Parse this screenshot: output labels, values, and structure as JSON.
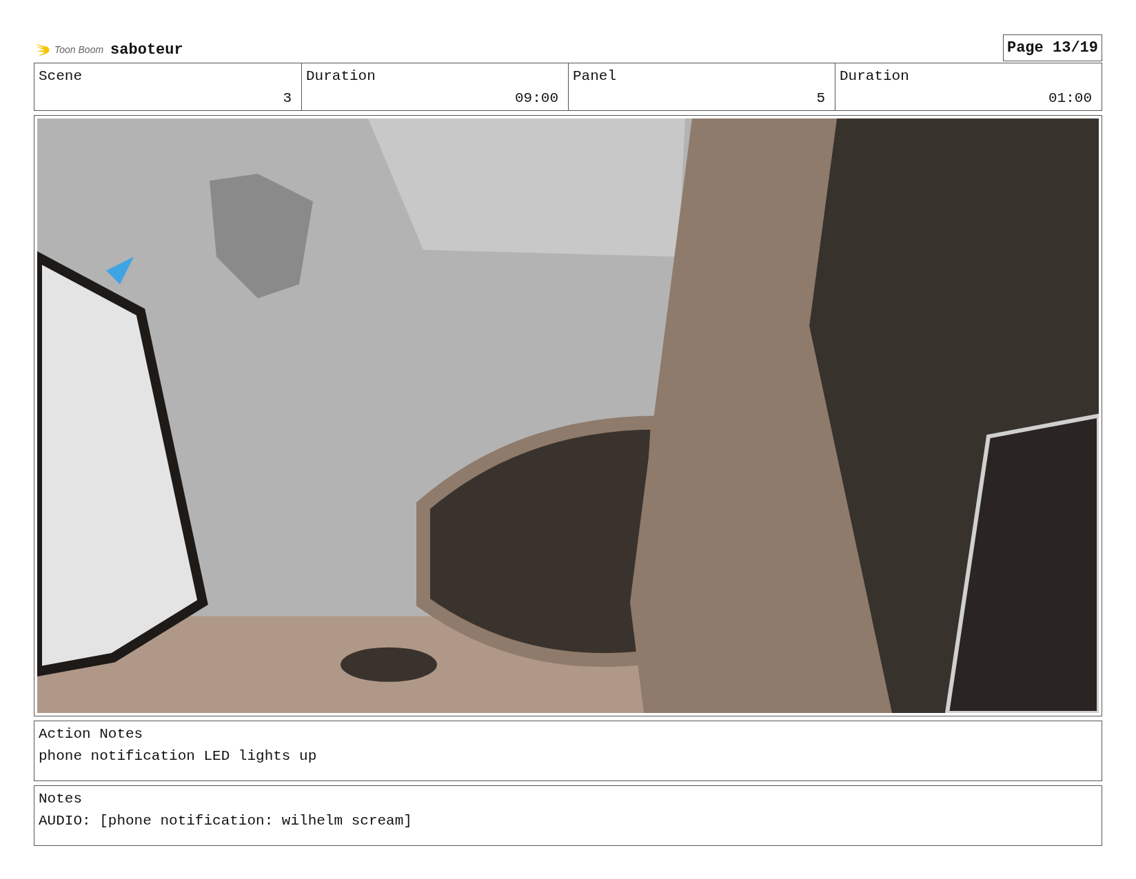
{
  "header": {
    "logo_text": "Toon Boom",
    "title": "saboteur",
    "page": "Page 13/19"
  },
  "info": [
    {
      "label": "Scene",
      "value": "3"
    },
    {
      "label": "Duration",
      "value": "09:00"
    },
    {
      "label": "Panel",
      "value": "5"
    },
    {
      "label": "Duration",
      "value": "01:00"
    }
  ],
  "action_notes": {
    "label": "Action Notes",
    "text": "phone notification LED lights up"
  },
  "notes": {
    "label": "Notes",
    "text": "AUDIO: [phone notification: wilhelm scream]"
  }
}
